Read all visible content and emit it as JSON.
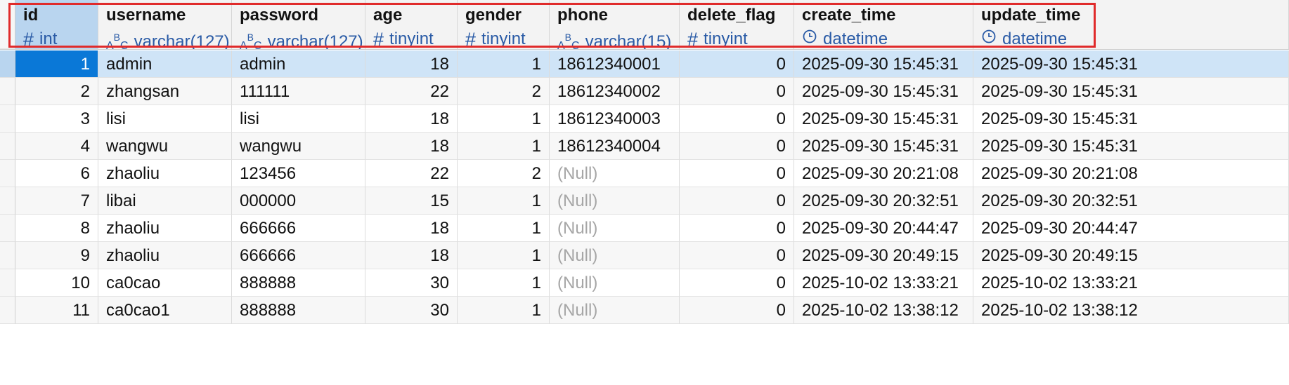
{
  "columns": [
    {
      "name": "id",
      "type": "int",
      "icon": "hash-icon",
      "align": "right"
    },
    {
      "name": "username",
      "type": "varchar(127)",
      "icon": "abc-icon",
      "align": "left"
    },
    {
      "name": "password",
      "type": "varchar(127)",
      "icon": "abc-icon",
      "align": "left"
    },
    {
      "name": "age",
      "type": "tinyint",
      "icon": "hash-icon",
      "align": "right"
    },
    {
      "name": "gender",
      "type": "tinyint",
      "icon": "hash-icon",
      "align": "right"
    },
    {
      "name": "phone",
      "type": "varchar(15)",
      "icon": "abc-icon",
      "align": "left"
    },
    {
      "name": "delete_flag",
      "type": "tinyint",
      "icon": "hash-icon",
      "align": "right"
    },
    {
      "name": "create_time",
      "type": "datetime",
      "icon": "clock-icon",
      "align": "left"
    },
    {
      "name": "update_time",
      "type": "datetime",
      "icon": "clock-icon",
      "align": "left"
    }
  ],
  "rows": [
    [
      "1",
      "admin",
      "admin",
      "18",
      "1",
      "18612340001",
      "0",
      "2025-09-30 15:45:31",
      "2025-09-30 15:45:31"
    ],
    [
      "2",
      "zhangsan",
      "111111",
      "22",
      "2",
      "18612340002",
      "0",
      "2025-09-30 15:45:31",
      "2025-09-30 15:45:31"
    ],
    [
      "3",
      "lisi",
      "lisi",
      "18",
      "1",
      "18612340003",
      "0",
      "2025-09-30 15:45:31",
      "2025-09-30 15:45:31"
    ],
    [
      "4",
      "wangwu",
      "wangwu",
      "18",
      "1",
      "18612340004",
      "0",
      "2025-09-30 15:45:31",
      "2025-09-30 15:45:31"
    ],
    [
      "6",
      "zhaoliu",
      "123456",
      "22",
      "2",
      "(Null)",
      "0",
      "2025-09-30 20:21:08",
      "2025-09-30 20:21:08"
    ],
    [
      "7",
      "libai",
      "000000",
      "15",
      "1",
      "(Null)",
      "0",
      "2025-09-30 20:32:51",
      "2025-09-30 20:32:51"
    ],
    [
      "8",
      "zhaoliu",
      "666666",
      "18",
      "1",
      "(Null)",
      "0",
      "2025-09-30 20:44:47",
      "2025-09-30 20:44:47"
    ],
    [
      "9",
      "zhaoliu",
      "666666",
      "18",
      "1",
      "(Null)",
      "0",
      "2025-09-30 20:49:15",
      "2025-09-30 20:49:15"
    ],
    [
      "10",
      "ca0cao",
      "888888",
      "30",
      "1",
      "(Null)",
      "0",
      "2025-10-02 13:33:21",
      "2025-10-02 13:33:21"
    ],
    [
      "11",
      "ca0cao1",
      "888888",
      "30",
      "1",
      "(Null)",
      "0",
      "2025-10-02 13:38:12",
      "2025-10-02 13:38:12"
    ]
  ],
  "selected_row_index": 0,
  "null_text": "(Null)",
  "colors": {
    "header_bg": "#f3f3f3",
    "selected_header_bg": "#b9d5ef",
    "selected_cell_bg": "#0a78d7",
    "selected_row_bg": "#cfe4f7",
    "type_text": "#2a5ba6",
    "null_text": "#a6a6a6",
    "highlight_outline": "#e02b2b"
  }
}
